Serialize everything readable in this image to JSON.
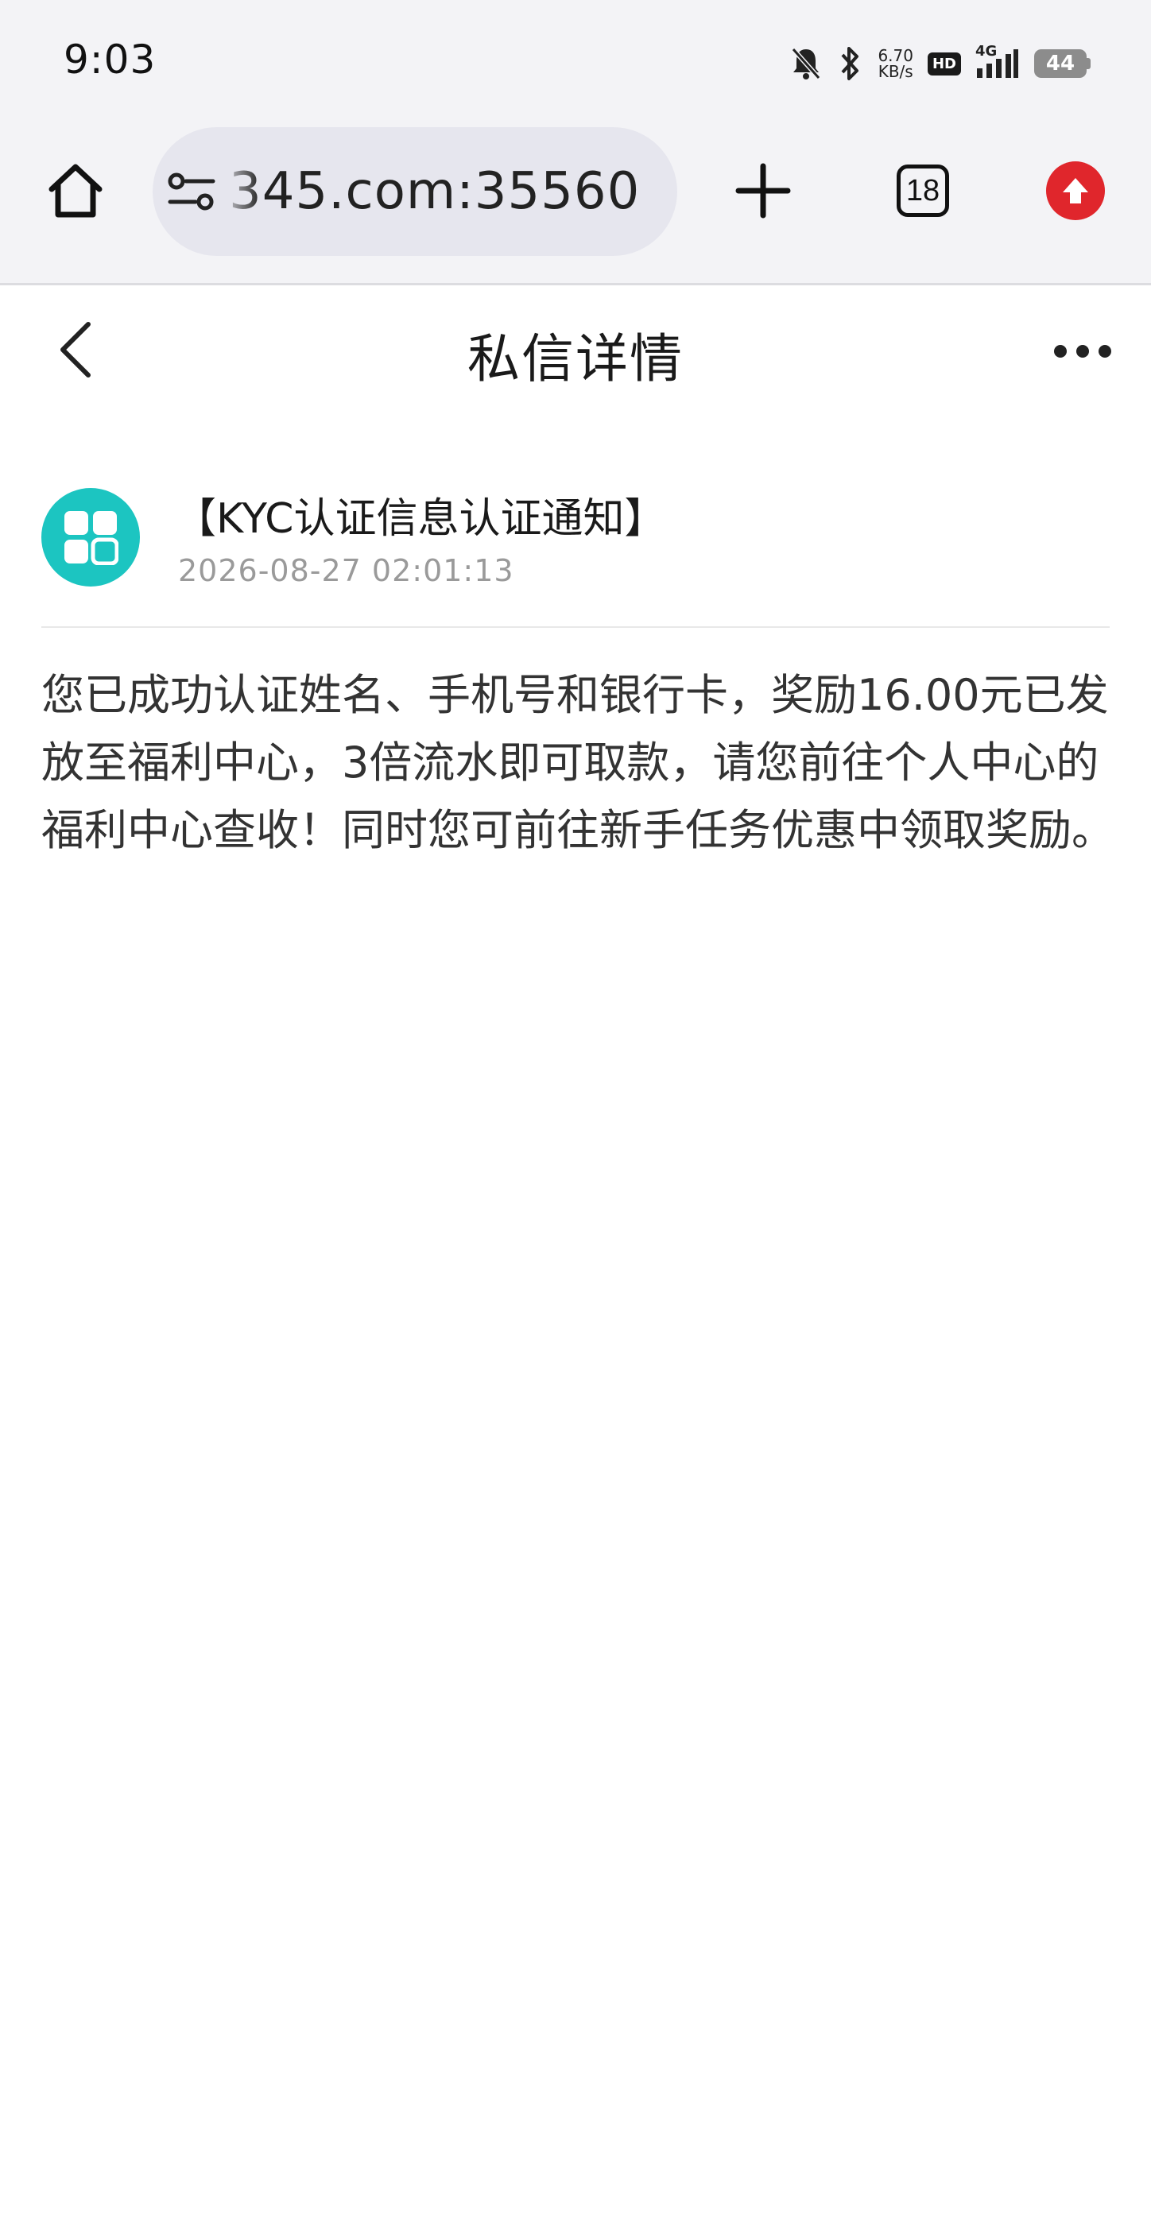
{
  "status_bar": {
    "time": "9:03",
    "net_speed_value": "6.70",
    "net_speed_unit": "KB/s",
    "hd_label": "HD",
    "network_type": "4G",
    "battery_level": "44",
    "icons": [
      "mute-icon",
      "bluetooth-icon",
      "signal-icon",
      "battery-icon"
    ]
  },
  "browser": {
    "url": "345.com:35560",
    "tab_count": "18",
    "update_color": "#e0262c"
  },
  "page": {
    "title": "私信详情"
  },
  "message": {
    "title": "【KYC认证信息认证通知】",
    "timestamp": "2026-08-27 02:01:13",
    "body": "您已成功认证姓名、手机号和银行卡，奖励16.00元已发放至福利中心，3倍流水即可取款，请您前往个人中心的福利中心查收！同时您可前往新手任务优惠中领取奖励。",
    "avatar_color": "#1cc5c1"
  }
}
